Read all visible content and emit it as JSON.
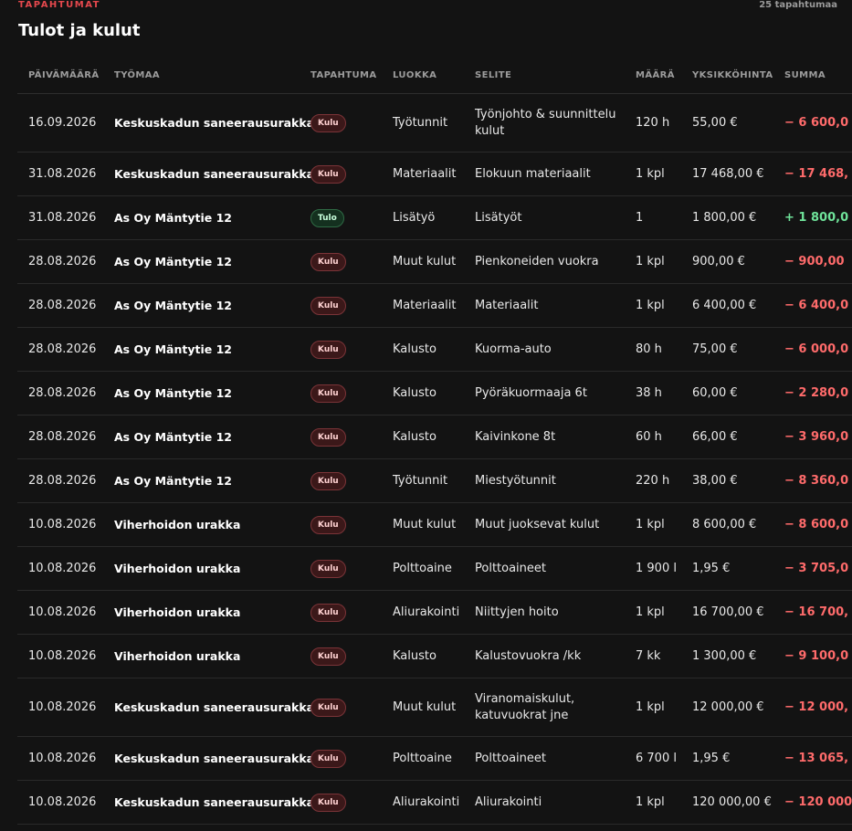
{
  "header": {
    "eyebrow": "TAPAHTUMAT",
    "count": "25 tapahtumaa",
    "title": "Tulot ja kulut"
  },
  "table": {
    "columns": {
      "date": "PÄIVÄMÄÄRÄ",
      "site": "TYÖMAA",
      "type": "TAPAHTUMA",
      "category": "LUOKKA",
      "description": "SELITE",
      "quantity": "MÄÄRÄ",
      "unit_price": "YKSIKKÖHINTA",
      "total": "SUMMA"
    },
    "rows": [
      {
        "date": "16.09.2026",
        "site": "Keskuskadun saneerausurakka",
        "type": "Kulu",
        "category": "Työtunnit",
        "description": "Työnjohto & suunnittelu kulut",
        "quantity": "120 h",
        "unit_price": "55,00 €",
        "total": "− 6 600,0"
      },
      {
        "date": "31.08.2026",
        "site": "Keskuskadun saneerausurakka",
        "type": "Kulu",
        "category": "Materiaalit",
        "description": "Elokuun materiaalit",
        "quantity": "1 kpl",
        "unit_price": "17 468,00 €",
        "total": "− 17 468,"
      },
      {
        "date": "31.08.2026",
        "site": "As Oy Mäntytie 12",
        "type": "Tulo",
        "category": "Lisätyö",
        "description": "Lisätyöt",
        "quantity": "1",
        "unit_price": "1 800,00 €",
        "total": "+ 1 800,0"
      },
      {
        "date": "28.08.2026",
        "site": "As Oy Mäntytie 12",
        "type": "Kulu",
        "category": "Muut kulut",
        "description": "Pienkoneiden vuokra",
        "quantity": "1 kpl",
        "unit_price": "900,00 €",
        "total": "− 900,00"
      },
      {
        "date": "28.08.2026",
        "site": "As Oy Mäntytie 12",
        "type": "Kulu",
        "category": "Materiaalit",
        "description": "Materiaalit",
        "quantity": "1 kpl",
        "unit_price": "6 400,00 €",
        "total": "− 6 400,0"
      },
      {
        "date": "28.08.2026",
        "site": "As Oy Mäntytie 12",
        "type": "Kulu",
        "category": "Kalusto",
        "description": "Kuorma-auto",
        "quantity": "80 h",
        "unit_price": "75,00 €",
        "total": "− 6 000,0"
      },
      {
        "date": "28.08.2026",
        "site": "As Oy Mäntytie 12",
        "type": "Kulu",
        "category": "Kalusto",
        "description": "Pyöräkuormaaja 6t",
        "quantity": "38 h",
        "unit_price": "60,00 €",
        "total": "− 2 280,0"
      },
      {
        "date": "28.08.2026",
        "site": "As Oy Mäntytie 12",
        "type": "Kulu",
        "category": "Kalusto",
        "description": "Kaivinkone 8t",
        "quantity": "60 h",
        "unit_price": "66,00 €",
        "total": "− 3 960,0"
      },
      {
        "date": "28.08.2026",
        "site": "As Oy Mäntytie 12",
        "type": "Kulu",
        "category": "Työtunnit",
        "description": "Miestyötunnit",
        "quantity": "220 h",
        "unit_price": "38,00 €",
        "total": "− 8 360,0"
      },
      {
        "date": "10.08.2026",
        "site": "Viherhoidon urakka",
        "type": "Kulu",
        "category": "Muut kulut",
        "description": "Muut juoksevat kulut",
        "quantity": "1 kpl",
        "unit_price": "8 600,00 €",
        "total": "− 8 600,0"
      },
      {
        "date": "10.08.2026",
        "site": "Viherhoidon urakka",
        "type": "Kulu",
        "category": "Polttoaine",
        "description": "Polttoaineet",
        "quantity": "1 900 l",
        "unit_price": "1,95 €",
        "total": "− 3 705,0"
      },
      {
        "date": "10.08.2026",
        "site": "Viherhoidon urakka",
        "type": "Kulu",
        "category": "Aliurakointi",
        "description": "Niittyjen hoito",
        "quantity": "1 kpl",
        "unit_price": "16 700,00 €",
        "total": "− 16 700,"
      },
      {
        "date": "10.08.2026",
        "site": "Viherhoidon urakka",
        "type": "Kulu",
        "category": "Kalusto",
        "description": "Kalustovuokra /kk",
        "quantity": "7 kk",
        "unit_price": "1 300,00 €",
        "total": "− 9 100,0"
      },
      {
        "date": "10.08.2026",
        "site": "Keskuskadun saneerausurakka",
        "type": "Kulu",
        "category": "Muut kulut",
        "description": "Viranomaiskulut, katuvuokrat jne",
        "quantity": "1 kpl",
        "unit_price": "12 000,00 €",
        "total": "− 12 000,"
      },
      {
        "date": "10.08.2026",
        "site": "Keskuskadun saneerausurakka",
        "type": "Kulu",
        "category": "Polttoaine",
        "description": "Polttoaineet",
        "quantity": "6 700 l",
        "unit_price": "1,95 €",
        "total": "− 13 065,"
      },
      {
        "date": "10.08.2026",
        "site": "Keskuskadun saneerausurakka",
        "type": "Kulu",
        "category": "Aliurakointi",
        "description": "Aliurakointi",
        "quantity": "1 kpl",
        "unit_price": "120 000,00 €",
        "total": "− 120 000"
      }
    ]
  }
}
